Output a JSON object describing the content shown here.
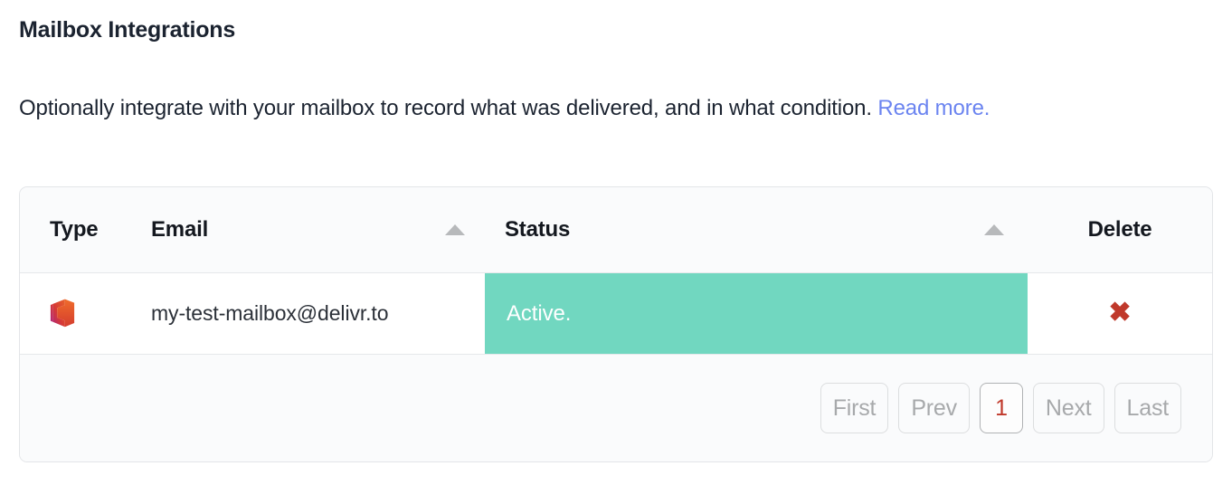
{
  "page": {
    "title": "Mailbox Integrations",
    "description_text": "Optionally integrate with your mailbox to record what was delivered, and in what condition.",
    "read_more_label": "Read more."
  },
  "colors": {
    "heading": "#1b2330",
    "link": "#6b84f0",
    "status_active_bg": "#71d7c0",
    "status_active_text": "#ffffff",
    "delete_icon": "#c0392b",
    "active_page": "#c0392b",
    "border": "#e3e5e8",
    "header_bg": "#fafbfc"
  },
  "table": {
    "columns": [
      {
        "key": "type",
        "label": "Type",
        "sortable": false,
        "sort_icon": ""
      },
      {
        "key": "email",
        "label": "Email",
        "sortable": true,
        "sort_icon": "sort-ascending-icon"
      },
      {
        "key": "status",
        "label": "Status",
        "sortable": true,
        "sort_icon": "sort-ascending-icon"
      },
      {
        "key": "delete",
        "label": "Delete",
        "sortable": false,
        "sort_icon": ""
      }
    ],
    "rows": [
      {
        "type_icon": "office365-icon",
        "type_label": "Office 365",
        "email": "my-test-mailbox@delivr.to",
        "status": "Active.",
        "delete_icon": "red-x-delete-icon",
        "delete_glyph": "✖"
      }
    ]
  },
  "pagination": {
    "first_label": "First",
    "prev_label": "Prev",
    "current_page": "1",
    "next_label": "Next",
    "last_label": "Last"
  }
}
